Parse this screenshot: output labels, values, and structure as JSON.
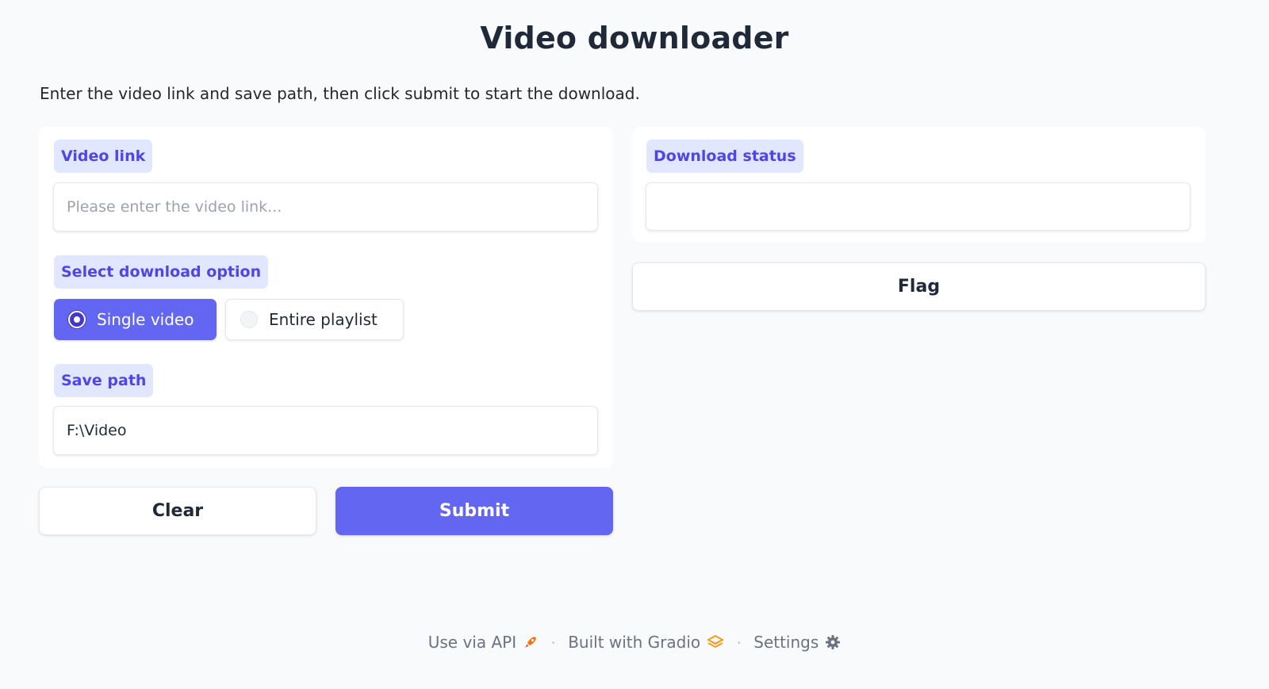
{
  "header": {
    "title": "Video downloader",
    "description": "Enter the video link and save path, then click submit to start the download."
  },
  "inputs": {
    "video_link": {
      "label": "Video link",
      "placeholder": "Please enter the video link...",
      "value": ""
    },
    "download_option": {
      "label": "Select download option",
      "options": [
        "Single video",
        "Entire playlist"
      ],
      "selected": "Single video"
    },
    "save_path": {
      "label": "Save path",
      "value": "F:\\Video"
    }
  },
  "actions": {
    "clear_label": "Clear",
    "submit_label": "Submit"
  },
  "output": {
    "status_label": "Download status",
    "status_value": "",
    "flag_label": "Flag"
  },
  "footer": {
    "api_label": "Use via API",
    "built_label": "Built with Gradio",
    "settings_label": "Settings"
  },
  "colors": {
    "accent": "#6366f1",
    "label_bg": "#e0e7ff",
    "label_text": "#4f46e5",
    "background": "#f9fafb"
  }
}
